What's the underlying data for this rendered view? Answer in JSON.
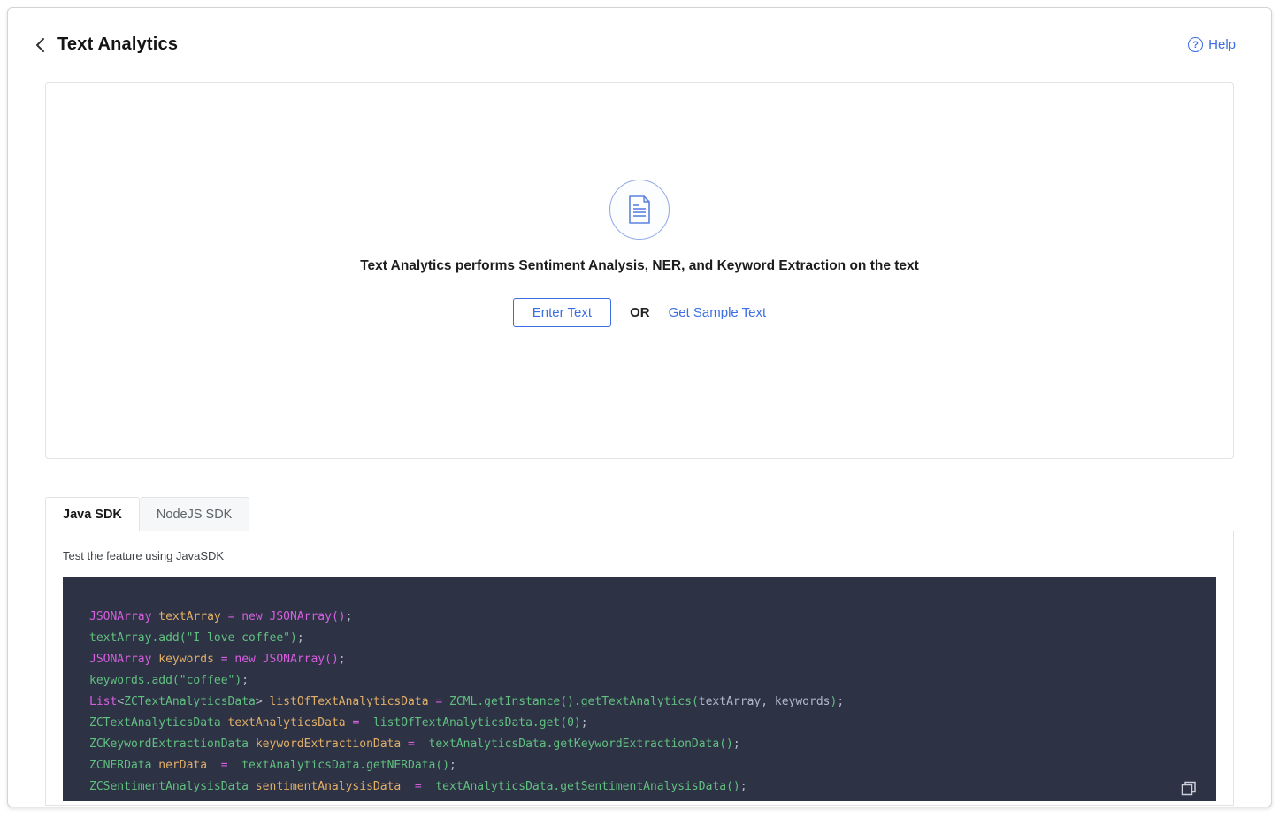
{
  "header": {
    "title": "Text Analytics",
    "help_label": "Help",
    "help_icon_glyph": "?"
  },
  "empty_state": {
    "description": "Text Analytics performs Sentiment Analysis, NER, and Keyword Extraction on the text",
    "enter_text_label": "Enter Text",
    "or_label": "OR",
    "sample_link_label": "Get Sample Text"
  },
  "tabs": [
    {
      "label": "Java SDK",
      "active": true
    },
    {
      "label": "NodeJS SDK",
      "active": false
    }
  ],
  "sdk_panel": {
    "hint": "Test the feature using JavaSDK"
  },
  "code": {
    "lines": [
      [
        [
          "k",
          "JSONArray "
        ],
        [
          "v",
          "textArray "
        ],
        [
          "k",
          "= new JSONArray()"
        ],
        [
          "p",
          ";"
        ]
      ],
      [
        [
          "f",
          "textArray.add(\"I love coffee\")"
        ],
        [
          "p",
          ";"
        ]
      ],
      [
        [
          "k",
          "JSONArray "
        ],
        [
          "v",
          "keywords "
        ],
        [
          "k",
          "= new JSONArray()"
        ],
        [
          "p",
          ";"
        ]
      ],
      [
        [
          "f",
          "keywords.add(\"coffee\")"
        ],
        [
          "p",
          ";"
        ]
      ],
      [
        [
          "k",
          "List"
        ],
        [
          "p",
          "<"
        ],
        [
          "f",
          "ZCTextAnalyticsData"
        ],
        [
          "p",
          "> "
        ],
        [
          "v",
          "listOfTextAnalyticsData "
        ],
        [
          "k",
          "= "
        ],
        [
          "f",
          "ZCML.getInstance().getTextAnalytics("
        ],
        [
          "p",
          "textArray, keywords"
        ],
        [
          "f",
          ")"
        ],
        [
          "p",
          ";"
        ]
      ],
      [
        [
          "f",
          "ZCTextAnalyticsData "
        ],
        [
          "v",
          "textAnalyticsData "
        ],
        [
          "k",
          "=  "
        ],
        [
          "f",
          "listOfTextAnalyticsData.get(0)"
        ],
        [
          "p",
          ";"
        ]
      ],
      [
        [
          "f",
          "ZCKeywordExtractionData "
        ],
        [
          "v",
          "keywordExtractionData "
        ],
        [
          "k",
          "=  "
        ],
        [
          "f",
          "textAnalyticsData.getKeywordExtractionData()"
        ],
        [
          "p",
          ";"
        ]
      ],
      [
        [
          "f",
          "ZCNERData "
        ],
        [
          "v",
          "nerData  "
        ],
        [
          "k",
          "=  "
        ],
        [
          "f",
          "textAnalyticsData.getNERData()"
        ],
        [
          "p",
          ";"
        ]
      ],
      [
        [
          "f",
          "ZCSentimentAnalysisData "
        ],
        [
          "v",
          "sentimentAnalysisData  "
        ],
        [
          "k",
          "=  "
        ],
        [
          "f",
          "textAnalyticsData.getSentimentAnalysisData()"
        ],
        [
          "p",
          ";"
        ]
      ]
    ]
  },
  "colors": {
    "accent_blue": "#3b6de4",
    "code_bg": "#2d3245",
    "code_pink": "#d55fde",
    "code_green": "#61bf7f",
    "code_orange": "#e2af68",
    "code_plain": "#b3bac7"
  }
}
